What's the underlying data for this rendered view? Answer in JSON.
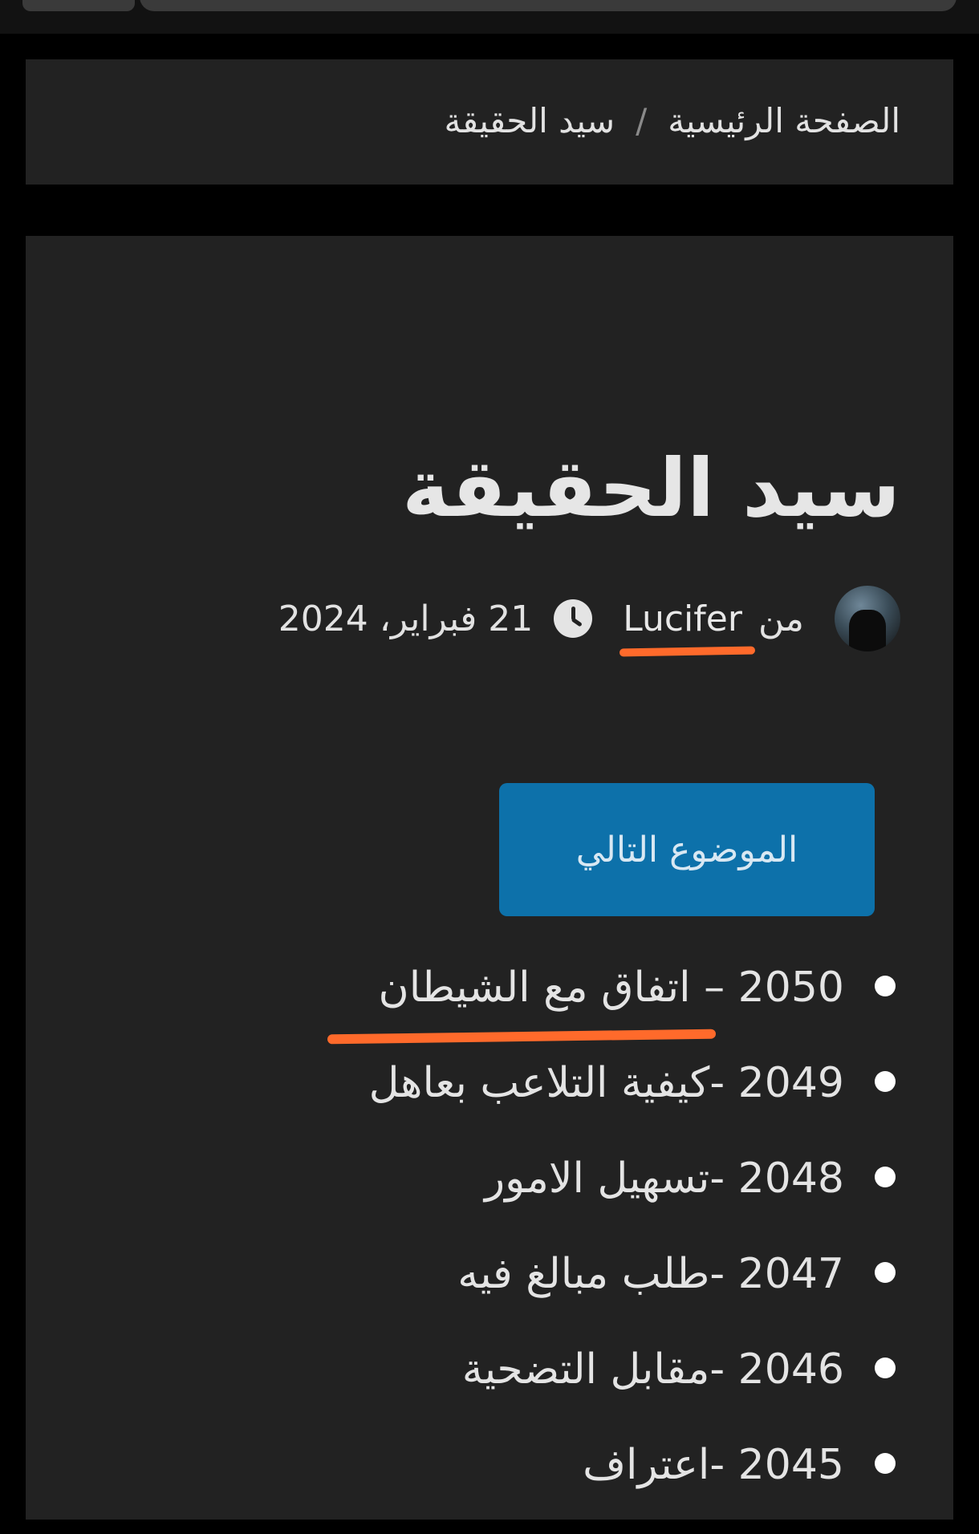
{
  "breadcrumb": {
    "home_label": "الصفحة الرئيسية",
    "separator": "/",
    "current_label": "سيد الحقيقة"
  },
  "post": {
    "title": "سيد الحقيقة",
    "by_label": "من",
    "author": "Lucifer",
    "date": "21 فبراير، 2024"
  },
  "next_button": {
    "label": "الموضوع التالي"
  },
  "topics": [
    {
      "label": "2050 – اتفاق مع الشيطان"
    },
    {
      "label": "2049 -كيفية التلاعب بعاهل"
    },
    {
      "label": "2048 -تسهيل الامور"
    },
    {
      "label": "2047 -طلب مبالغ فيه"
    },
    {
      "label": "2046 -مقابل التضحية"
    },
    {
      "label": "2045 -اعتراف"
    }
  ],
  "annotation_color": "#ff6a2b",
  "button_color": "#0d71aa",
  "icons": [
    "avatar",
    "clock-icon",
    "bullet-icon"
  ]
}
